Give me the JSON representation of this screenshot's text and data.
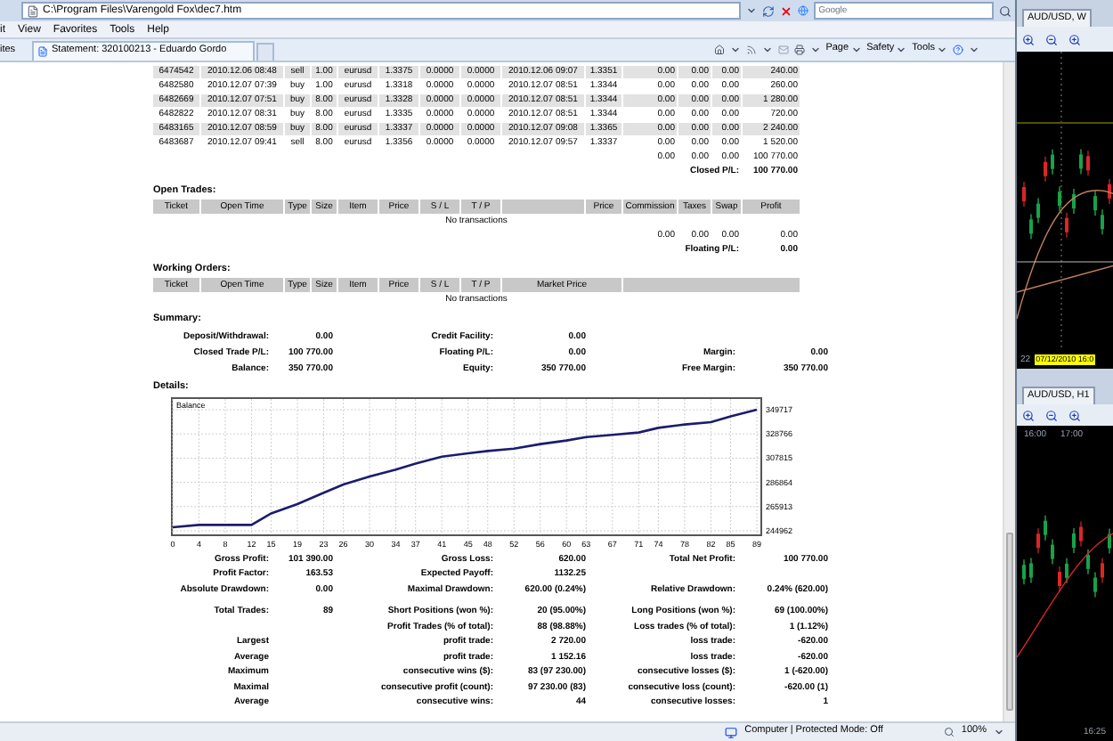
{
  "browser": {
    "address": "C:\\Program Files\\Varengold Fox\\dec7.htm",
    "search_placeholder": "Google",
    "menu": [
      "it",
      "View",
      "Favorites",
      "Tools",
      "Help"
    ],
    "favorites_label": "ites",
    "tab": "Statement: 320100213 - Eduardo Gordo",
    "commands": [
      "Page",
      "Safety",
      "Tools"
    ],
    "status": "Computer | Protected Mode: Off",
    "zoom": "100%"
  },
  "closed_trades": {
    "rows": [
      [
        "6474542",
        "2010.12.06 08:48",
        "sell",
        "1.00",
        "eurusd",
        "1.3375",
        "0.0000",
        "0.0000",
        "2010.12.06 09:07",
        "1.3351",
        "0.00",
        "0.00",
        "0.00",
        "240.00"
      ],
      [
        "6482580",
        "2010.12.07 07:39",
        "buy",
        "1.00",
        "eurusd",
        "1.3318",
        "0.0000",
        "0.0000",
        "2010.12.07 08:51",
        "1.3344",
        "0.00",
        "0.00",
        "0.00",
        "260.00"
      ],
      [
        "6482669",
        "2010.12.07 07:51",
        "buy",
        "8.00",
        "eurusd",
        "1.3328",
        "0.0000",
        "0.0000",
        "2010.12.07 08:51",
        "1.3344",
        "0.00",
        "0.00",
        "0.00",
        "1 280.00"
      ],
      [
        "6482822",
        "2010.12.07 08:31",
        "buy",
        "8.00",
        "eurusd",
        "1.3335",
        "0.0000",
        "0.0000",
        "2010.12.07 08:51",
        "1.3344",
        "0.00",
        "0.00",
        "0.00",
        "720.00"
      ],
      [
        "6483165",
        "2010.12.07 08:59",
        "buy",
        "8.00",
        "eurusd",
        "1.3337",
        "0.0000",
        "0.0000",
        "2010.12.07 09:08",
        "1.3365",
        "0.00",
        "0.00",
        "0.00",
        "2 240.00"
      ],
      [
        "6483687",
        "2010.12.07 09:41",
        "sell",
        "8.00",
        "eurusd",
        "1.3356",
        "0.0000",
        "0.0000",
        "2010.12.07 09:57",
        "1.3337",
        "0.00",
        "0.00",
        "0.00",
        "1 520.00"
      ]
    ],
    "totals": [
      "0.00",
      "0.00",
      "0.00",
      "100 770.00"
    ],
    "total_label": "Closed P/L:",
    "total_value": "100 770.00"
  },
  "open_trades": {
    "title": "Open Trades:",
    "columns": [
      {
        "kind": "cell",
        "label": "Ticket"
      },
      {
        "kind": "cell",
        "label": "Open Time"
      },
      {
        "kind": "cell",
        "label": "Type"
      },
      {
        "kind": "cell",
        "label": "Size"
      },
      {
        "kind": "cell",
        "label": "Item"
      },
      {
        "kind": "cell",
        "label": "Price"
      },
      {
        "kind": "cell",
        "label": "S / L"
      },
      {
        "kind": "cell",
        "label": "T / P"
      },
      {
        "kind": "blank"
      },
      {
        "kind": "cell",
        "label": "Price"
      },
      {
        "kind": "cell",
        "label": "Commission"
      },
      {
        "kind": "cell",
        "label": "Taxes"
      },
      {
        "kind": "cell",
        "label": "Swap"
      },
      {
        "kind": "cell",
        "label": "Profit"
      }
    ],
    "empty": "No transactions",
    "totals": [
      "0.00",
      "0.00",
      "0.00",
      "0.00"
    ],
    "total_label": "Floating P/L:",
    "total_value": "0.00"
  },
  "working_orders": {
    "title": "Working Orders:",
    "columns": [
      {
        "kind": "cell",
        "label": "Ticket"
      },
      {
        "kind": "cell",
        "label": "Open Time"
      },
      {
        "kind": "cell",
        "label": "Type"
      },
      {
        "kind": "cell",
        "label": "Size"
      },
      {
        "kind": "cell",
        "label": "Item"
      },
      {
        "kind": "cell",
        "label": "Price"
      },
      {
        "kind": "cell",
        "label": "S / L"
      },
      {
        "kind": "cell",
        "label": "T / P"
      },
      {
        "kind": "wide",
        "label": "Market Price"
      },
      {
        "kind": "filler"
      }
    ],
    "empty": "No transactions"
  },
  "summary": {
    "title": "Summary:",
    "rows": [
      {
        "label_1": "Deposit/Withdrawal:",
        "value_1": "0.00",
        "label_2": "Credit Facility:",
        "value_2": "0.00"
      },
      {
        "label_1": "Closed Trade P/L:",
        "value_1": "100 770.00",
        "label_2": "Floating P/L:",
        "value_2": "0.00",
        "label_3": "Margin:",
        "value_3": "0.00"
      },
      {
        "label_1": "Balance:",
        "value_1": "350 770.00",
        "label_2": "Equity:",
        "value_2": "350 770.00",
        "label_3": "Free Margin:",
        "value_3": "350 770.00"
      }
    ]
  },
  "details": {
    "title": "Details:",
    "chart_data": {
      "type": "line",
      "grid": true,
      "x": [
        0,
        4,
        8,
        12,
        15,
        19,
        23,
        26,
        30,
        34,
        37,
        41,
        45,
        48,
        52,
        56,
        60,
        63,
        67,
        71,
        74,
        78,
        82,
        85,
        89
      ],
      "series": [
        {
          "name": "Balance",
          "color": "#1c1c6e",
          "values": [
            248000,
            250000,
            250000,
            250000,
            260000,
            268000,
            278000,
            285000,
            292000,
            298000,
            303000,
            309000,
            312000,
            314000,
            316000,
            320000,
            323000,
            326000,
            328000,
            330000,
            334000,
            337000,
            339000,
            344000,
            349700
          ]
        }
      ],
      "xlim": [
        0,
        89
      ],
      "ylim": [
        244962,
        349717
      ],
      "xticks": [
        0,
        4,
        8,
        12,
        15,
        19,
        23,
        26,
        30,
        34,
        37,
        41,
        45,
        48,
        52,
        56,
        60,
        63,
        67,
        71,
        74,
        78,
        82,
        85,
        89
      ],
      "yticks": [
        244962,
        265913,
        286864,
        307815,
        328766,
        349717
      ]
    }
  },
  "stats": [
    {
      "label_1": "Gross Profit:",
      "value_1": "101 390.00",
      "label_2": "Gross Loss:",
      "value_2": "620.00",
      "label_3": "Total Net Profit:",
      "value_3": "100 770.00"
    },
    {
      "label_1": "Profit Factor:",
      "value_1": "163.53",
      "label_2": "Expected Payoff:",
      "value_2": "1132.25"
    },
    {
      "label_1": "Absolute Drawdown:",
      "value_1": "0.00",
      "label_2": "Maximal Drawdown:",
      "value_2": "620.00 (0.24%)",
      "label_3": "Relative Drawdown:",
      "value_3": "0.24% (620.00)"
    },
    {
      "kind": "gap"
    },
    {
      "label_1": "Total Trades:",
      "value_1": "89",
      "label_2": "Short Positions (won %):",
      "value_2": "20 (95.00%)",
      "label_3": "Long Positions (won %):",
      "value_3": "69 (100.00%)"
    },
    {
      "label_2": "Profit Trades (% of total):",
      "value_2": "88 (98.88%)",
      "label_3": "Loss trades (% of total):",
      "value_3": "1 (1.12%)"
    },
    {
      "label_1": "Largest",
      "label_2": "profit trade:",
      "value_2": "2 720.00",
      "label_3": "loss trade:",
      "value_3": "-620.00"
    },
    {
      "label_1": "Average",
      "label_2": "profit trade:",
      "value_2": "1 152.16",
      "label_3": "loss trade:",
      "value_3": "-620.00"
    },
    {
      "label_1": "Maximum",
      "label_2": "consecutive wins ($):",
      "value_2": "83 (97 230.00)",
      "label_3": "consecutive losses ($):",
      "value_3": "1 (-620.00)"
    },
    {
      "label_1": "Maximal",
      "label_2": "consecutive profit (count):",
      "value_2": "97 230.00 (83)",
      "label_3": "consecutive loss (count):",
      "value_3": "-620.00 (1)"
    },
    {
      "label_1": "Average",
      "label_2": "consecutive wins:",
      "value_2": "44",
      "label_3": "consecutive losses:",
      "value_3": "1"
    }
  ],
  "platform": {
    "tabs": [
      "AUD/USD, W",
      "AUD/USD, H1"
    ],
    "date_day": "22",
    "date_marker": "07/12/2010 16:0",
    "times": [
      "16:00",
      "17:00"
    ],
    "bottom_time": "16:25"
  }
}
